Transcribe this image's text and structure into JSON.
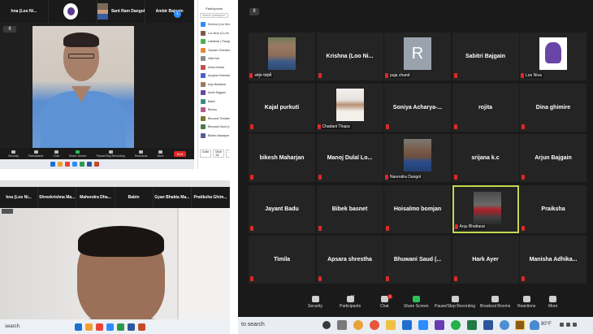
{
  "top_left": {
    "strip": [
      "hna (Loo Ni...",
      "",
      "Sant Ram Dangol",
      "Ambir Bajgain"
    ],
    "panel_title": "Participants",
    "panel_search": "Search participant",
    "participants": [
      "Krishna (Loo Niva)",
      "Loo Niva (Co-Ho",
      "Udhaban ( Ranga",
      "Gautum Shrestha",
      "Uttar kali",
      "Amba Kesari",
      "Ayojana Shrestha",
      "Anju Bhattarai",
      "Ambir Bajgain",
      "Babin",
      "Bishna",
      "Bhuwani Timalsina",
      "Bhuwani Saud (s",
      "Bikesh Maharjan"
    ],
    "panel_buttons": [
      "Invite",
      "Mute All",
      "..."
    ],
    "blue_badge": "1",
    "toolbar": [
      "Security",
      "Participants",
      "Chat",
      "Share Screen",
      "Pause/Stop Recording",
      "Reactions",
      "More"
    ],
    "end_label": "End",
    "pause_label": "II"
  },
  "bottom_left": {
    "strip": [
      "hna (Loo Ni...",
      "Shreekrishna Ma...",
      "Mahendra Dha...",
      "Babin",
      "Gyan Bhakta Ma...",
      "Pratiksha Ghim..."
    ],
    "search": "search"
  },
  "right": {
    "pause_label": "II",
    "tiles": [
      {
        "label": "अमृत घाइसे",
        "photo": "man"
      },
      {
        "name": "Krishna (Loo Ni..."
      },
      {
        "label": "puja chand",
        "photo": "avatar",
        "avatar_letter": "R"
      },
      {
        "name": "Sabitri Bajgain"
      },
      {
        "label": "Loo Niva",
        "photo": "logo"
      },
      {
        "name": "Kajal purkuti"
      },
      {
        "label": "Chadani Thapa",
        "photo": "woman"
      },
      {
        "name": "Soniya  Acharya-..."
      },
      {
        "name": "rojita"
      },
      {
        "name": "Dina ghimire"
      },
      {
        "name": "bikesh Maharjan"
      },
      {
        "name": "Manoj Dulal Lo..."
      },
      {
        "label": "Narendra Dangol",
        "photo": "man2"
      },
      {
        "name": "srijana k.c"
      },
      {
        "name": "Arjun Bajgain"
      },
      {
        "name": "Jayant Badu"
      },
      {
        "name": "Bibek basnet"
      },
      {
        "name": "Hoisalmo bomjan"
      },
      {
        "label": "Anju Bhattarai",
        "photo": "outdoor",
        "active": true
      },
      {
        "name": "Praiksha"
      },
      {
        "name": "Timila"
      },
      {
        "name": "Apsara shrestha"
      },
      {
        "name": "Bhuwani Saud (..."
      },
      {
        "name": "Hark Ayer"
      },
      {
        "name": "Manisha  Adhika..."
      }
    ],
    "toolbar": {
      "security": "Security",
      "participants": "Participants",
      "participants_count": "47",
      "chat": "Chat",
      "chat_badge": "1",
      "share": "Share Screen",
      "record": "Pause/Stop Recording",
      "breakout": "Breakout Rooms",
      "reactions": "Reactions",
      "more": "More"
    },
    "taskbar": {
      "search": "to search",
      "temp": "80°F"
    }
  },
  "colors": {
    "zoom_dark": "#1a1a1a",
    "tile": "#242424",
    "active_border": "#c6d650",
    "end_red": "#e02828",
    "share_green": "#2ebd59",
    "zoom_blue": "#2d8cff"
  }
}
